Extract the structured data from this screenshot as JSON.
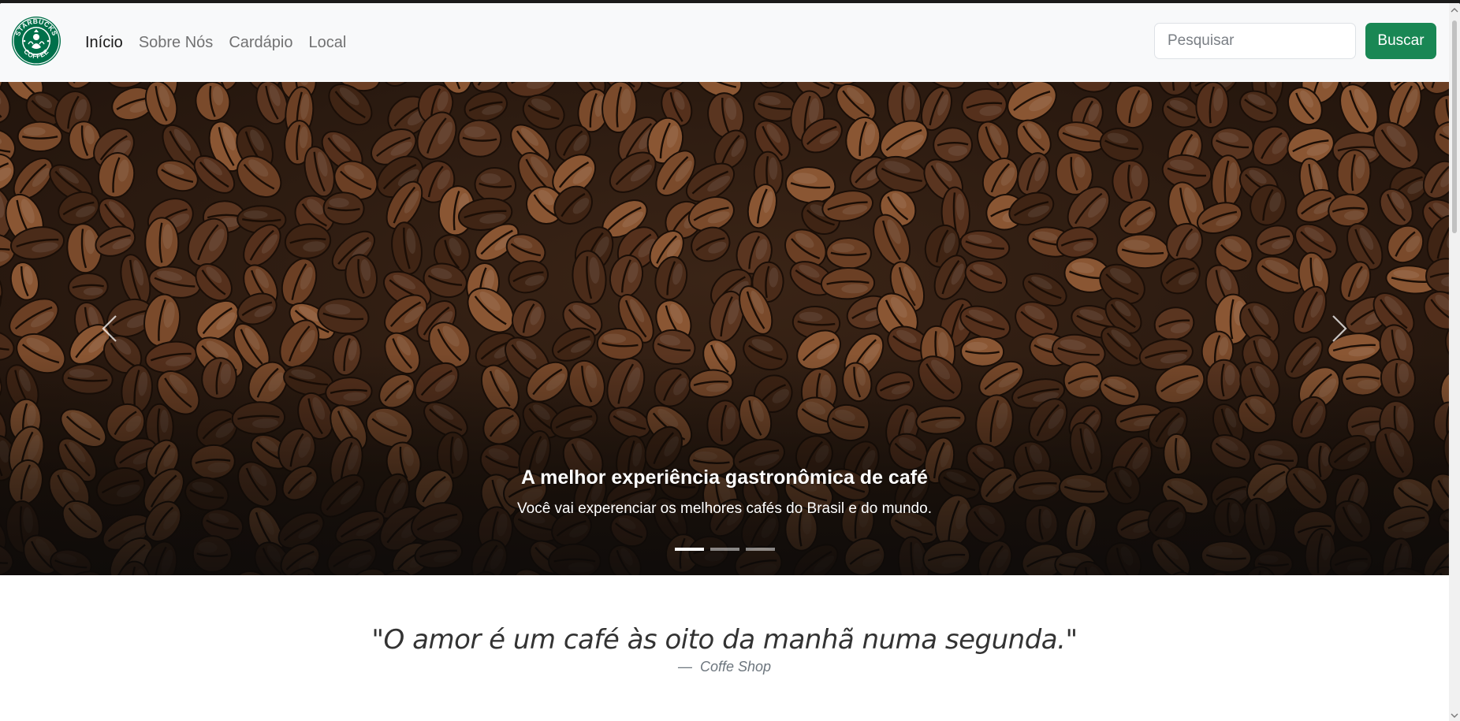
{
  "logo": {
    "icon": "starbucks-logo",
    "text_top": "STARBUCKS",
    "text_bottom": "COFFEE"
  },
  "nav": {
    "items": [
      {
        "label": "Início",
        "active": true
      },
      {
        "label": "Sobre Nós",
        "active": false
      },
      {
        "label": "Cardápio",
        "active": false
      },
      {
        "label": "Local",
        "active": false
      }
    ]
  },
  "search": {
    "placeholder": "Pesquisar",
    "value": "",
    "button_label": "Buscar",
    "button_color": "#198754"
  },
  "carousel": {
    "caption_title": "A melhor experiência gastronômica de café",
    "caption_text": "Você vai experenciar os melhores cafés do Brasil e do mundo.",
    "slides_count": 3,
    "active_slide": 1,
    "prev_icon": "chevron-left-icon",
    "next_icon": "chevron-right-icon"
  },
  "quote": {
    "text": "\"O amor é um café às oito da manhã numa segunda.\"",
    "author": "Coffe Shop",
    "dash": "—"
  },
  "colors": {
    "navbar_bg": "#f8f9fa",
    "accent": "#198754",
    "logo_green": "#00704a"
  }
}
